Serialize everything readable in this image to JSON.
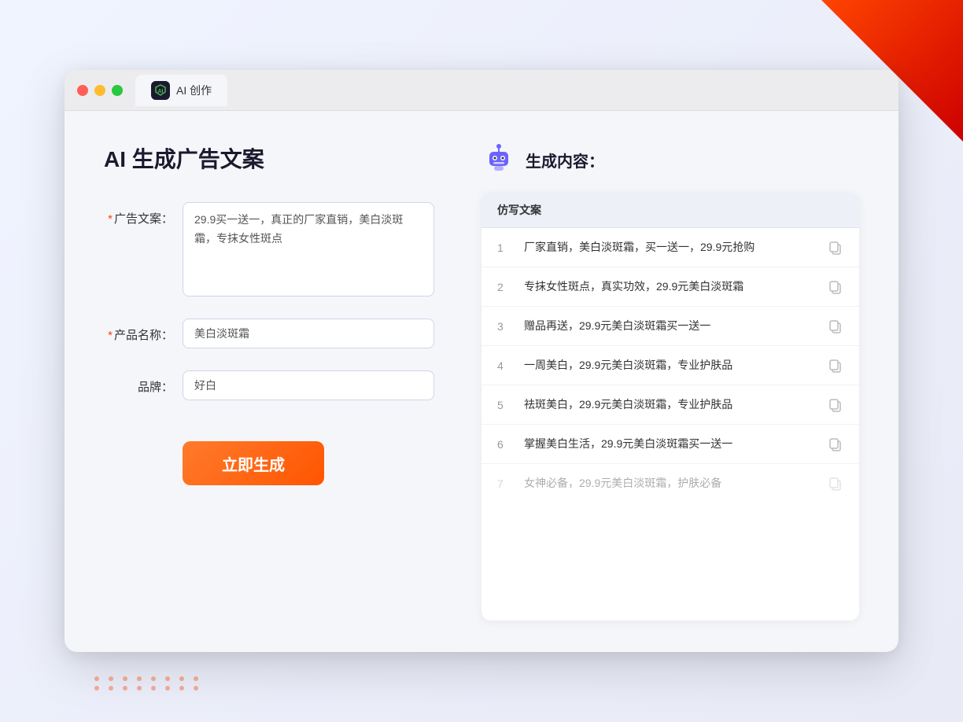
{
  "browser": {
    "tab_label": "AI 创作",
    "tab_icon": "AI"
  },
  "page": {
    "title": "AI 生成广告文案",
    "right_title": "生成内容："
  },
  "form": {
    "ad_copy_label": "广告文案：",
    "ad_copy_required": "*",
    "ad_copy_value": "29.9买一送一，真正的厂家直销，美白淡斑霜，专抹女性斑点",
    "product_name_label": "产品名称：",
    "product_name_required": "*",
    "product_name_value": "美白淡斑霜",
    "brand_label": "品牌：",
    "brand_value": "好白",
    "generate_btn": "立即生成"
  },
  "results": {
    "header": "仿写文案",
    "items": [
      {
        "num": "1",
        "text": "厂家直销，美白淡斑霜，买一送一，29.9元抢购",
        "faded": false
      },
      {
        "num": "2",
        "text": "专抹女性斑点，真实功效，29.9元美白淡斑霜",
        "faded": false
      },
      {
        "num": "3",
        "text": "赠品再送，29.9元美白淡斑霜买一送一",
        "faded": false
      },
      {
        "num": "4",
        "text": "一周美白，29.9元美白淡斑霜，专业护肤品",
        "faded": false
      },
      {
        "num": "5",
        "text": "祛斑美白，29.9元美白淡斑霜，专业护肤品",
        "faded": false
      },
      {
        "num": "6",
        "text": "掌握美白生活，29.9元美白淡斑霜买一送一",
        "faded": false
      },
      {
        "num": "7",
        "text": "女神必备，29.9元美白淡斑霜，护肤必备",
        "faded": true
      }
    ]
  },
  "colors": {
    "accent": "#ff5500",
    "brand": "#4CAF50",
    "required": "#ff4400"
  }
}
